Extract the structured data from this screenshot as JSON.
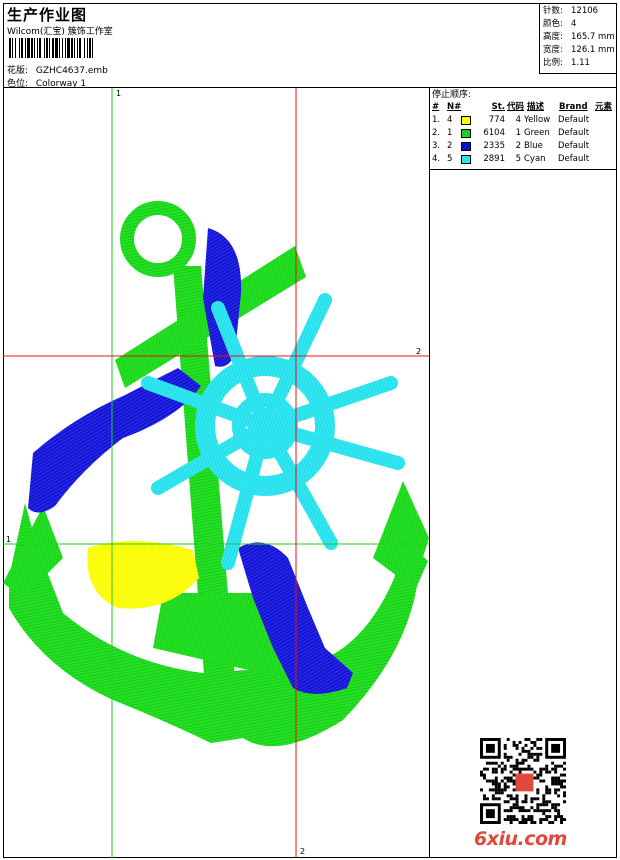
{
  "header": {
    "title": "生产作业图",
    "company": "Wilcom(汇宝) 簇饰工作室",
    "design_label": "花版:",
    "design_value": "GZHC4637.emb",
    "colorway_label": "色位:",
    "colorway_value": "Colorway 1"
  },
  "stats": {
    "stitches_label": "针数:",
    "stitches_value": "12106",
    "colors_label": "颜色:",
    "colors_value": "4",
    "height_label": "高度:",
    "height_value": "165.7 mm",
    "width_label": "宽度:",
    "width_value": "126.1 mm",
    "scale_label": "比例:",
    "scale_value": "1.11"
  },
  "stop_sequence": {
    "label": "停止顺序:",
    "columns": [
      "#",
      "N#",
      "St.",
      "代码",
      "描述",
      "Brand",
      "元素"
    ],
    "rows": [
      {
        "idx": "1.",
        "n": "4",
        "color": "#ffff00",
        "st": "774",
        "code": "4",
        "desc": "Yellow",
        "brand": "Default"
      },
      {
        "idx": "2.",
        "n": "1",
        "color": "#22cc22",
        "st": "6104",
        "code": "1",
        "desc": "Green",
        "brand": "Default"
      },
      {
        "idx": "3.",
        "n": "2",
        "color": "#1010cc",
        "st": "2335",
        "code": "2",
        "desc": "Blue",
        "brand": "Default"
      },
      {
        "idx": "4.",
        "n": "5",
        "color": "#22e6f0",
        "st": "2891",
        "code": "5",
        "desc": "Cyan",
        "brand": "Default"
      }
    ]
  },
  "guides": {
    "green_v_label": "1",
    "green_h_label": "1",
    "red_h_label": "2",
    "red_v_label": "2"
  },
  "colors": {
    "green": "#22e022",
    "blue": "#1414d8",
    "cyan": "#30e8f2",
    "yellow": "#ffff10",
    "guide_green": "#22cc22",
    "guide_red": "#ee1111"
  },
  "watermark": "6xiu.com"
}
